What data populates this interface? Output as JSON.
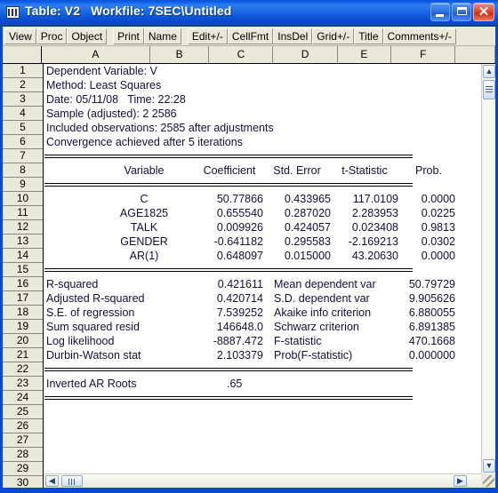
{
  "window": {
    "title": "Table: V2   Workfile: 7SEC\\Untitled",
    "icon": "table-icon",
    "minimize_label": "",
    "maximize_label": "",
    "close_label": "✕"
  },
  "toolbar": {
    "groups": [
      [
        "View",
        "Proc",
        "Object"
      ],
      [
        "Print",
        "Name"
      ],
      [
        "Edit+/-",
        "CellFmt",
        "InsDel",
        "Grid+/-",
        "Title",
        "Comments+/-"
      ]
    ]
  },
  "sheet": {
    "columns": [
      "A",
      "B",
      "C",
      "D",
      "E",
      "F"
    ],
    "row_numbers": [
      1,
      2,
      3,
      4,
      5,
      6,
      7,
      8,
      9,
      10,
      11,
      12,
      13,
      14,
      15,
      16,
      17,
      18,
      19,
      20,
      21,
      22,
      23,
      24,
      25,
      26,
      27,
      28,
      29,
      30
    ],
    "scrollbar": {
      "up_arrow": "▲",
      "down_arrow": "▼",
      "left_arrow": "◀",
      "right_arrow": "▶"
    }
  },
  "output": {
    "header_lines": [
      "Dependent Variable: V",
      "Method: Least Squares",
      "Date: 05/11/08   Time: 22:28",
      "Sample (adjusted): 2 2586",
      "Included observations: 2585 after adjustments",
      "Convergence achieved after 5 iterations"
    ],
    "table_headers": [
      "Variable",
      "Coefficient",
      "Std. Error",
      "t-Statistic",
      "Prob."
    ],
    "coefficients": [
      {
        "variable": "C",
        "coefficient": "50.77866",
        "std_error": "0.433965",
        "t_statistic": "117.0109",
        "prob": "0.0000"
      },
      {
        "variable": "AGE1825",
        "coefficient": "0.655540",
        "std_error": "0.287020",
        "t_statistic": "2.283953",
        "prob": "0.0225"
      },
      {
        "variable": "TALK",
        "coefficient": "0.009926",
        "std_error": "0.424057",
        "t_statistic": "0.023408",
        "prob": "0.9813"
      },
      {
        "variable": "GENDER",
        "coefficient": "-0.641182",
        "std_error": "0.295583",
        "t_statistic": "-2.169213",
        "prob": "0.0302"
      },
      {
        "variable": "AR(1)",
        "coefficient": "0.648097",
        "std_error": "0.015000",
        "t_statistic": "43.20630",
        "prob": "0.0000"
      }
    ],
    "statistics": [
      {
        "left_label": "R-squared",
        "left_value": "0.421611",
        "right_label": "Mean dependent var",
        "right_value": "50.79729"
      },
      {
        "left_label": "Adjusted R-squared",
        "left_value": "0.420714",
        "right_label": "S.D. dependent var",
        "right_value": "9.905626"
      },
      {
        "left_label": "S.E. of regression",
        "left_value": "7.539252",
        "right_label": "Akaike info criterion",
        "right_value": "6.880055"
      },
      {
        "left_label": "Sum squared resid",
        "left_value": "146648.0",
        "right_label": "Schwarz criterion",
        "right_value": "6.891385"
      },
      {
        "left_label": "Log likelihood",
        "left_value": "-8887.472",
        "right_label": "F-statistic",
        "right_value": "470.1668"
      },
      {
        "left_label": "Durbin-Watson stat",
        "left_value": "2.103379",
        "right_label": "Prob(F-statistic)",
        "right_value": "0.000000"
      }
    ],
    "footer": {
      "label": "Inverted AR Roots",
      "value": ".65"
    }
  },
  "colors": {
    "titlebar": "#1060e8",
    "toolbar_bg": "#eae9d9",
    "header_bg": "#eae9d9",
    "text": "#10103a",
    "close_button": "#cc2f14"
  }
}
